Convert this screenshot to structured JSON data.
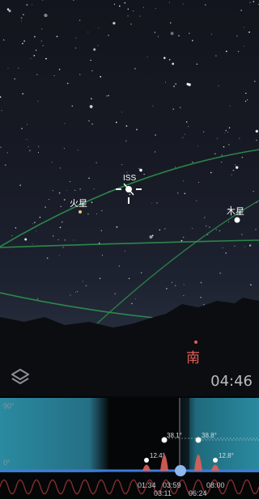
{
  "sky": {
    "objects": [
      {
        "name": "ISS"
      },
      {
        "name": "火星"
      },
      {
        "name": "木星"
      }
    ],
    "compass_direction": "南"
  },
  "toolbar": {
    "layers_icon": "layers-icon",
    "current_time": "04:46"
  },
  "timeline": {
    "axis_top_label": "90°",
    "axis_bottom_label": "0°",
    "passes": [
      {
        "max_elevation": "12.4°",
        "time": "01:34"
      },
      {
        "max_elevation": "38.1°",
        "time": "03:11"
      },
      {
        "max_elevation": "",
        "time": "03:59"
      },
      {
        "max_elevation": "38.8°",
        "time": "06:24"
      },
      {
        "max_elevation": "12.8°",
        "time": "08:00"
      }
    ],
    "colors": {
      "day": "#2a8aa0",
      "night": "#050608",
      "baseline": "#3d7bd8",
      "peak": "#e0605a",
      "cursor": "#8fb8ee"
    }
  }
}
